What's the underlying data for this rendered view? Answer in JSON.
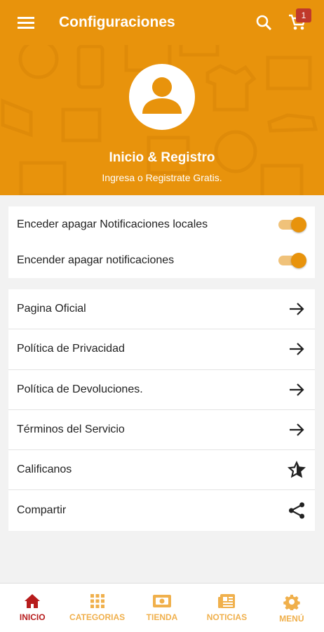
{
  "appbar": {
    "title": "Configuraciones",
    "cart_count": "1"
  },
  "hero": {
    "title": "Inicio & Registro",
    "subtitle": "Ingresa o Registrate Gratis."
  },
  "toggles": [
    {
      "label": "Enceder apagar Notificaciones locales",
      "on": true
    },
    {
      "label": "Encender apagar notificaciones",
      "on": true
    }
  ],
  "links": [
    {
      "label": "Pagina Oficial",
      "icon": "arrow-right-icon"
    },
    {
      "label": "Política de Privacidad",
      "icon": "arrow-right-icon"
    },
    {
      "label": "Política de Devoluciones.",
      "icon": "arrow-right-icon"
    },
    {
      "label": "Términos del Servicio",
      "icon": "arrow-right-icon"
    },
    {
      "label": "Calificanos",
      "icon": "star-icon"
    },
    {
      "label": "Compartir",
      "icon": "share-icon"
    }
  ],
  "nav": [
    {
      "label": "INICIO",
      "icon": "home-icon",
      "active": true
    },
    {
      "label": "CATEGORIAS",
      "icon": "grid-icon",
      "active": false
    },
    {
      "label": "TIENDA",
      "icon": "store-icon",
      "active": false
    },
    {
      "label": "NOTICIAS",
      "icon": "news-icon",
      "active": false
    },
    {
      "label": "MENÚ",
      "icon": "gear-icon",
      "active": false
    }
  ],
  "colors": {
    "primary": "#e8930c",
    "active": "#b71c1c",
    "inactive": "#f0b04c",
    "badge": "#c0392b"
  }
}
